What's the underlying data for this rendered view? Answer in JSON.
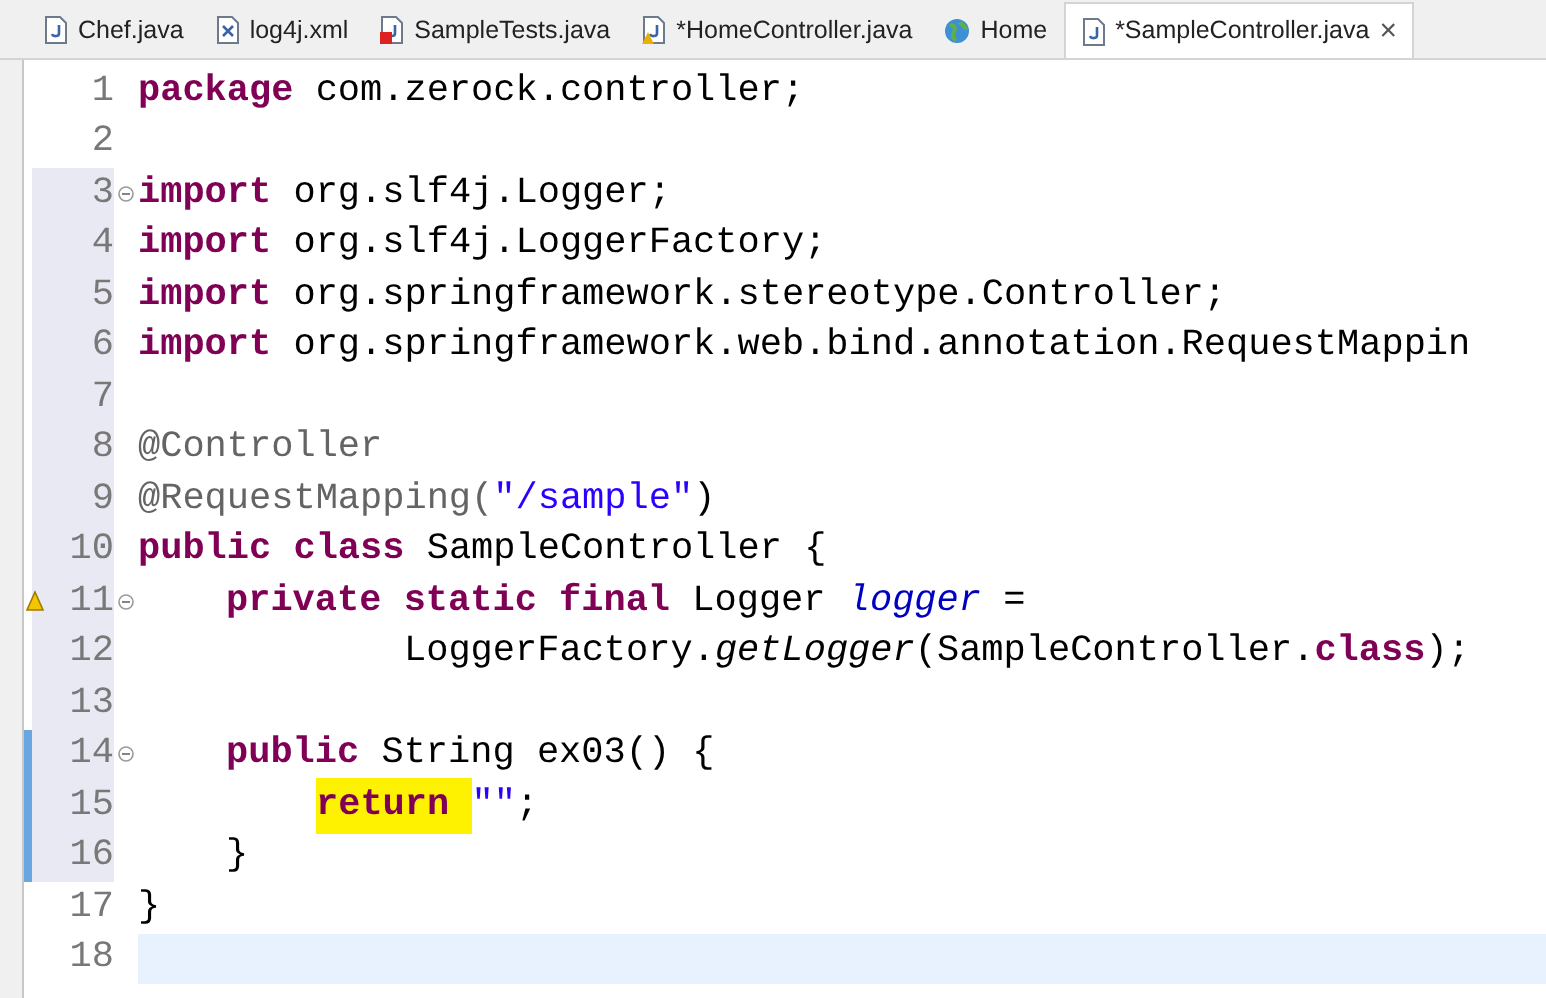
{
  "tabs": [
    {
      "label": "Chef.java",
      "kind": "java",
      "selected": false
    },
    {
      "label": "log4j.xml",
      "kind": "xml",
      "selected": false
    },
    {
      "label": "SampleTests.java",
      "kind": "java-error",
      "selected": false
    },
    {
      "label": "*HomeController.java",
      "kind": "java-warning",
      "selected": false
    },
    {
      "label": "Home",
      "kind": "web",
      "selected": false
    },
    {
      "label": "*SampleController.java",
      "kind": "java",
      "selected": true,
      "close": "×"
    }
  ],
  "lines": [
    {
      "number": "1",
      "kind": "top",
      "foldable": false,
      "warning": false,
      "changed": false,
      "in_range": false,
      "current": false,
      "tokens": [
        {
          "text": "package",
          "kind": "keyword"
        },
        {
          "text": " com.zerock.controller;",
          "kind": "plain"
        }
      ]
    },
    {
      "number": "2",
      "foldable": false,
      "warning": false,
      "changed": false,
      "in_range": false,
      "current": false
    },
    {
      "number": "3",
      "kind": "top",
      "foldable": true,
      "warning": false,
      "changed": false,
      "in_range": true,
      "current": false,
      "tokens": [
        {
          "text": "import",
          "kind": "keyword"
        },
        {
          "text": " org.slf4j.Logger;",
          "kind": "plain"
        }
      ]
    },
    {
      "number": "4",
      "kind": "top",
      "foldable": false,
      "warning": false,
      "changed": false,
      "in_range": true,
      "current": false,
      "tokens": [
        {
          "text": "import",
          "kind": "keyword"
        },
        {
          "text": " org.slf4j.LoggerFactory;",
          "kind": "plain"
        }
      ]
    },
    {
      "number": "5",
      "kind": "top",
      "foldable": false,
      "warning": false,
      "changed": false,
      "in_range": true,
      "current": false,
      "tokens": [
        {
          "text": "import",
          "kind": "keyword"
        },
        {
          "text": " org.springframework.stereotype.Controller;",
          "kind": "plain"
        }
      ]
    },
    {
      "number": "6",
      "kind": "top",
      "foldable": false,
      "warning": false,
      "changed": false,
      "in_range": true,
      "current": false,
      "tokens": [
        {
          "text": "import",
          "kind": "keyword"
        },
        {
          "text": " org.springframework.web.bind.annotation.RequestMappin",
          "kind": "plain"
        }
      ]
    },
    {
      "number": "7",
      "foldable": false,
      "warning": false,
      "changed": false,
      "in_range": true,
      "current": false
    },
    {
      "number": "8",
      "kind": "top",
      "foldable": false,
      "warning": false,
      "changed": false,
      "in_range": true,
      "current": false,
      "tokens": [
        {
          "text": "@Controller",
          "kind": "annotation"
        }
      ]
    },
    {
      "number": "9",
      "kind": "top",
      "foldable": false,
      "warning": false,
      "changed": false,
      "in_range": true,
      "current": false,
      "tokens": [
        {
          "text": "@RequestMapping(",
          "kind": "annotation"
        },
        {
          "text": "\"/sample\"",
          "kind": "string"
        },
        {
          "text": ")",
          "kind": "plain"
        }
      ]
    },
    {
      "number": "10",
      "kind": "top",
      "foldable": false,
      "warning": false,
      "changed": false,
      "in_range": true,
      "current": false,
      "tokens": [
        {
          "text": "public class",
          "kind": "keyword"
        },
        {
          "text": " SampleController {",
          "kind": "plain"
        }
      ]
    },
    {
      "number": "11",
      "kind": "member",
      "foldable": true,
      "warning": true,
      "changed": false,
      "in_range": true,
      "current": false,
      "tokens": [
        {
          "text": "private static final",
          "kind": "keyword"
        },
        {
          "text": " Logger ",
          "kind": "plain"
        },
        {
          "text": "logger",
          "kind": "field"
        },
        {
          "text": " =",
          "kind": "plain"
        }
      ]
    },
    {
      "number": "12",
      "kind": "continuation",
      "foldable": false,
      "warning": false,
      "changed": false,
      "in_range": true,
      "current": false,
      "tokens": [
        {
          "text": "LoggerFactory.",
          "kind": "plain"
        },
        {
          "text": "getLogger",
          "kind": "method"
        },
        {
          "text": "(SampleController.",
          "kind": "plain"
        },
        {
          "text": "class",
          "kind": "keyword"
        },
        {
          "text": ");",
          "kind": "plain"
        }
      ]
    },
    {
      "number": "13",
      "foldable": false,
      "warning": false,
      "changed": false,
      "in_range": true,
      "current": false
    },
    {
      "number": "14",
      "kind": "member",
      "foldable": true,
      "warning": false,
      "changed": true,
      "in_range": true,
      "current": false,
      "tokens": [
        {
          "text": "public",
          "kind": "keyword"
        },
        {
          "text": " String ex03() {",
          "kind": "plain"
        }
      ]
    },
    {
      "number": "15",
      "kind": "statement",
      "foldable": false,
      "warning": false,
      "changed": true,
      "in_range": true,
      "current": false,
      "tokens": [
        {
          "text": "return ",
          "kind": "keyword-marked"
        },
        {
          "text": "\"\"",
          "kind": "string"
        },
        {
          "text": ";",
          "kind": "plain"
        }
      ]
    },
    {
      "number": "16",
      "kind": "member",
      "foldable": false,
      "warning": false,
      "changed": true,
      "in_range": true,
      "current": false,
      "tokens": [
        {
          "text": "}",
          "kind": "plain"
        }
      ]
    },
    {
      "number": "17",
      "kind": "top",
      "foldable": false,
      "warning": false,
      "changed": false,
      "in_range": false,
      "current": false,
      "tokens": [
        {
          "text": "}",
          "kind": "plain"
        }
      ]
    },
    {
      "number": "18",
      "kind": "top",
      "foldable": false,
      "warning": false,
      "changed": false,
      "in_range": false,
      "current": true
    }
  ]
}
